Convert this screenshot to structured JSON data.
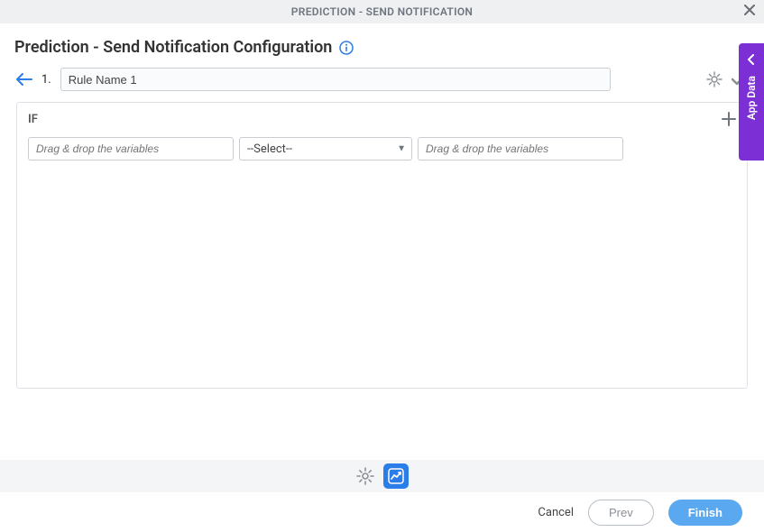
{
  "header": {
    "title": "PREDICTION - SEND NOTIFICATION"
  },
  "page": {
    "title": "Prediction - Send Notification Configuration"
  },
  "rule": {
    "index": "1.",
    "name": "Rule Name 1",
    "if_label": "IF",
    "left_placeholder": "Drag & drop the variables",
    "operator_placeholder": "--Select--",
    "right_placeholder": "Drag & drop the variables"
  },
  "side_tab": {
    "label": "App Data"
  },
  "footer": {
    "cancel": "Cancel",
    "prev": "Prev",
    "finish": "Finish"
  }
}
